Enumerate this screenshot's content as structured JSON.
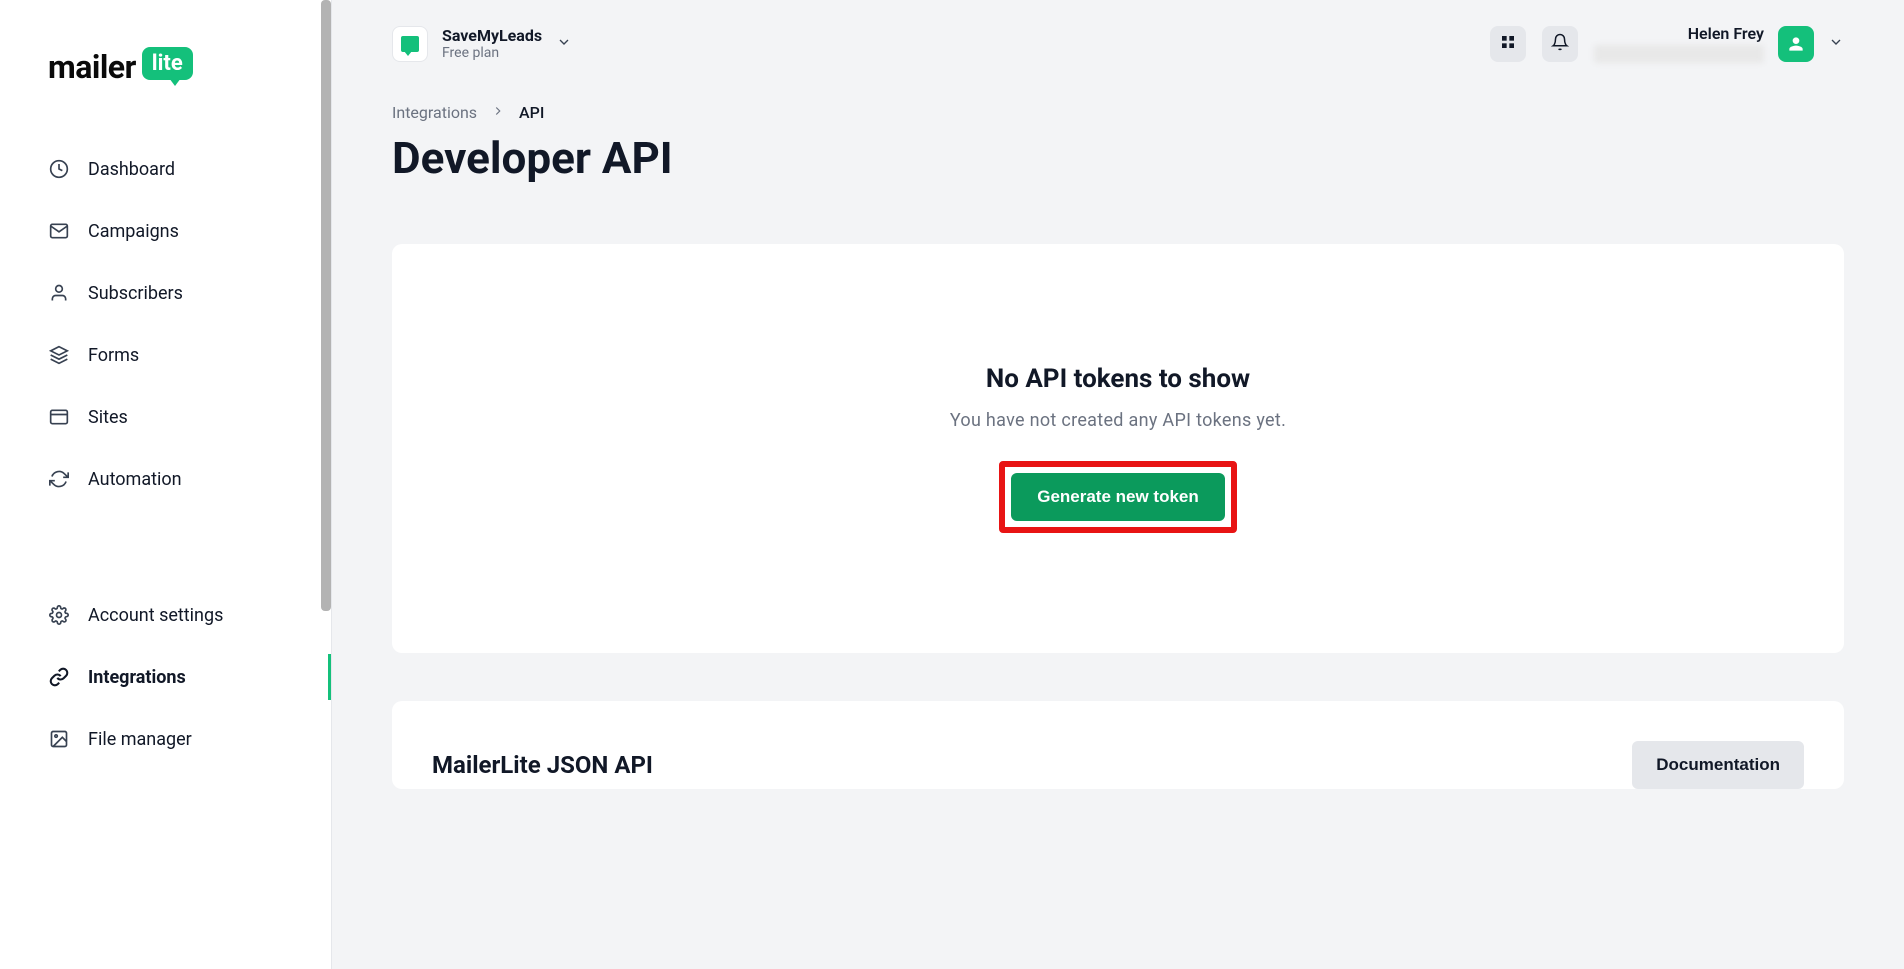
{
  "logo": {
    "text1": "mailer",
    "text2": "lite"
  },
  "sidebar": {
    "items": [
      {
        "label": "Dashboard",
        "icon": "clock-icon"
      },
      {
        "label": "Campaigns",
        "icon": "mail-icon"
      },
      {
        "label": "Subscribers",
        "icon": "user-icon"
      },
      {
        "label": "Forms",
        "icon": "layers-icon"
      },
      {
        "label": "Sites",
        "icon": "browser-icon"
      },
      {
        "label": "Automation",
        "icon": "refresh-icon"
      }
    ],
    "items2": [
      {
        "label": "Account settings",
        "icon": "gear-icon"
      },
      {
        "label": "Integrations",
        "icon": "link-icon",
        "active": true
      },
      {
        "label": "File manager",
        "icon": "image-icon"
      }
    ]
  },
  "header": {
    "account_name": "SaveMyLeads",
    "account_plan": "Free plan",
    "user_name": "Helen Frey"
  },
  "breadcrumb": {
    "parent": "Integrations",
    "current": "API"
  },
  "page": {
    "title": "Developer API"
  },
  "empty_state": {
    "title": "No API tokens to show",
    "subtitle": "You have not created any API tokens yet.",
    "button": "Generate new token"
  },
  "json_api": {
    "title": "MailerLite JSON API",
    "doc_button": "Documentation"
  }
}
